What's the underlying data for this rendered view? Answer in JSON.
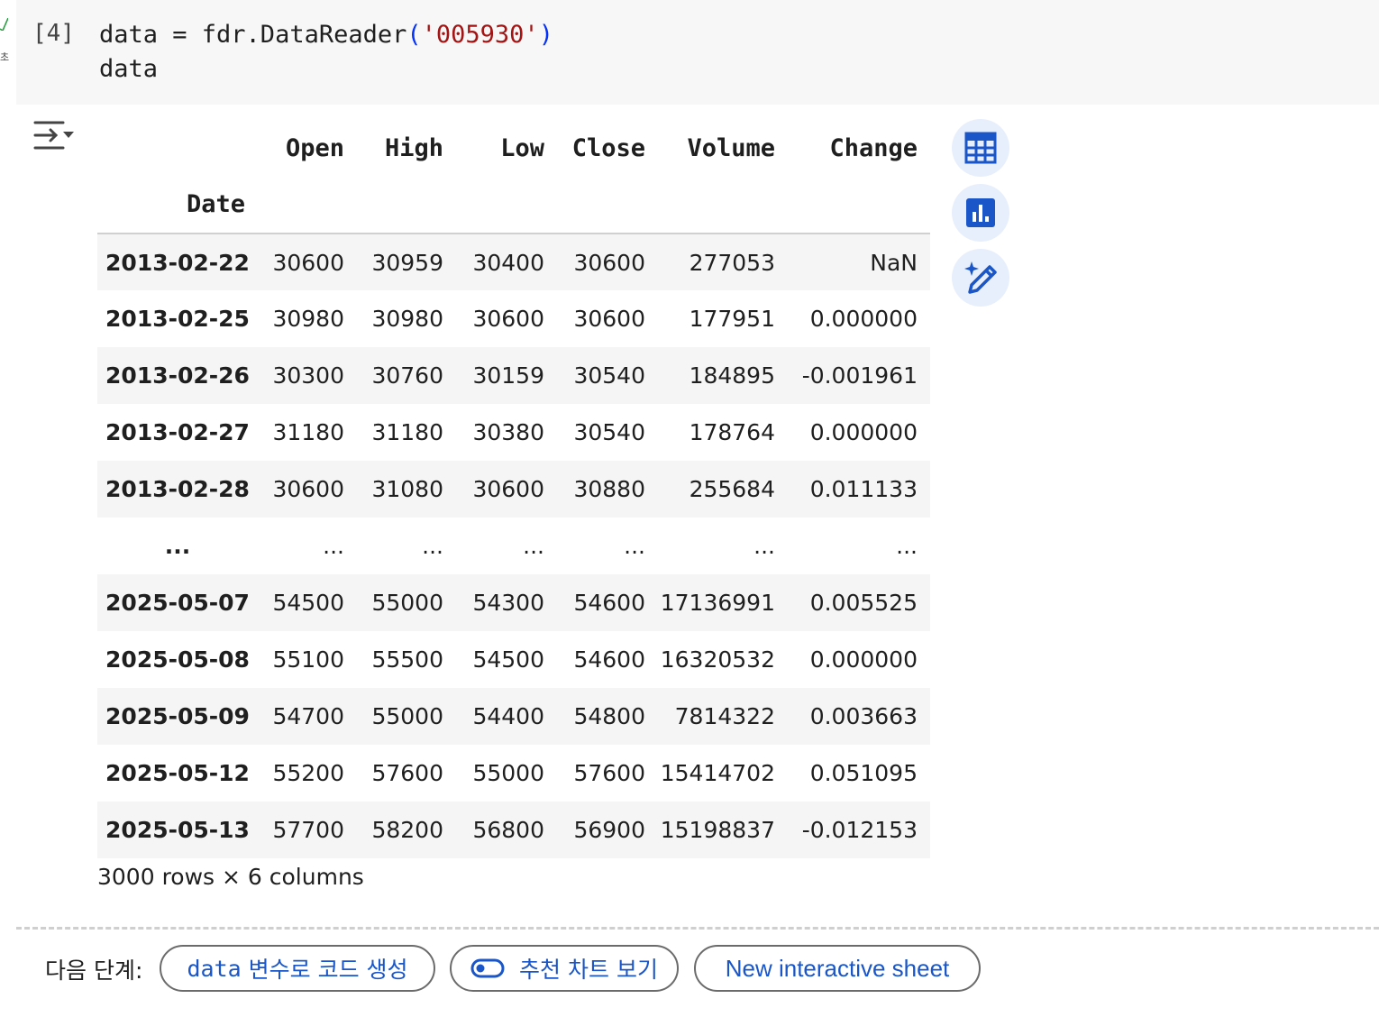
{
  "cell": {
    "execution_count": "[4]",
    "status_icon": "check-icon",
    "status_text": "초",
    "code_lines": {
      "line1_prefix": "data = fdr.DataReader",
      "line1_open": "(",
      "line1_arg": "'005930'",
      "line1_close": ")",
      "line2": "data"
    }
  },
  "output": {
    "toggle_icon": "output-collapse-icon",
    "table": {
      "columns": [
        "Open",
        "High",
        "Low",
        "Close",
        "Volume",
        "Change"
      ],
      "index_name": "Date",
      "rows": [
        {
          "index": "2013-02-22",
          "values": [
            "30600",
            "30959",
            "30400",
            "30600",
            "277053",
            "NaN"
          ]
        },
        {
          "index": "2013-02-25",
          "values": [
            "30980",
            "30980",
            "30600",
            "30600",
            "177951",
            "0.000000"
          ]
        },
        {
          "index": "2013-02-26",
          "values": [
            "30300",
            "30760",
            "30159",
            "30540",
            "184895",
            "-0.001961"
          ]
        },
        {
          "index": "2013-02-27",
          "values": [
            "31180",
            "31180",
            "30380",
            "30540",
            "178764",
            "0.000000"
          ]
        },
        {
          "index": "2013-02-28",
          "values": [
            "30600",
            "31080",
            "30600",
            "30880",
            "255684",
            "0.011133"
          ]
        },
        {
          "index": "...",
          "values": [
            "...",
            "...",
            "...",
            "...",
            "...",
            "..."
          ]
        },
        {
          "index": "2025-05-07",
          "values": [
            "54500",
            "55000",
            "54300",
            "54600",
            "17136991",
            "0.005525"
          ]
        },
        {
          "index": "2025-05-08",
          "values": [
            "55100",
            "55500",
            "54500",
            "54600",
            "16320532",
            "0.000000"
          ]
        },
        {
          "index": "2025-05-09",
          "values": [
            "54700",
            "55000",
            "54400",
            "54800",
            "7814322",
            "0.003663"
          ]
        },
        {
          "index": "2025-05-12",
          "values": [
            "55200",
            "57600",
            "55000",
            "57600",
            "15414702",
            "0.051095"
          ]
        },
        {
          "index": "2025-05-13",
          "values": [
            "57700",
            "58200",
            "56800",
            "56900",
            "15198837",
            "-0.012153"
          ]
        }
      ]
    },
    "shape_caption": "3000 rows × 6 columns",
    "side_buttons": [
      {
        "icon": "table-icon"
      },
      {
        "icon": "bar-chart-icon"
      },
      {
        "icon": "magic-pencil-icon"
      }
    ]
  },
  "next_steps": {
    "label": "다음 단계:",
    "chips": {
      "code_with_var": {
        "mono": "data",
        "text": " 변수로 코드 생성"
      },
      "recommended_charts": {
        "icon": "toggle-icon",
        "text": "추천 차트 보기"
      },
      "interactive_sheet": {
        "text": "New interactive sheet"
      }
    }
  },
  "colors": {
    "accent_blue": "#1a56c8",
    "string_red": "#a31515",
    "paren_blue": "#0431fa",
    "side_button_bg": "#e8effc",
    "stripe": "#f5f5f5"
  }
}
